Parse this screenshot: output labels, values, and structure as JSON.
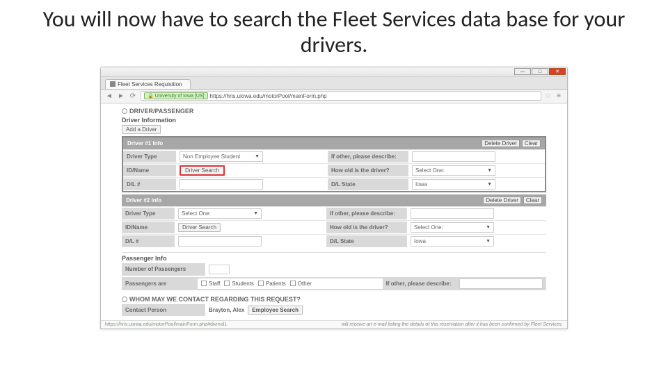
{
  "slide": {
    "title": "You will now have to search the Fleet Services data base for your drivers."
  },
  "browser": {
    "tab_title": "Fleet Services Requisition",
    "ev_badge": "University of Iowa [US]",
    "url": "https://hris.uiowa.edu/motorPool/mainForm.php",
    "status_url": "https://hris.uiowa.edu/motorPool/mainForm.php#divmid1",
    "status_note": "will receive an e-mail listing the details of this reservation after it has been confirmed by Fleet Services."
  },
  "form": {
    "section_header": "DRIVER/PASSENGER",
    "driver_info_heading": "Driver Information",
    "add_driver_btn": "Add a Driver",
    "driver_bars": [
      "Driver #1 Info",
      "Driver #2 Info"
    ],
    "bar_buttons": {
      "delete": "Delete Driver",
      "clear": "Clear"
    },
    "labels": {
      "driver_type": "Driver Type",
      "id_name": "ID/Name",
      "dl_num": "D/L #",
      "other_desc": "If other, please describe:",
      "how_old": "How old is the driver?",
      "dl_state": "D/L State"
    },
    "driver1": {
      "type": "Non Employee Student",
      "search_btn": "Driver Search",
      "age": "Select One:",
      "state": "Iowa"
    },
    "driver2": {
      "type": "Select One:",
      "search_btn": "Driver Search",
      "age": "Select One:",
      "state": "Iowa"
    },
    "passenger": {
      "heading": "Passenger Info",
      "num_label": "Number of Passengers",
      "are_label": "Passengers are",
      "options": [
        "Staff",
        "Students",
        "Patients",
        "Other"
      ],
      "other_label": "If other, please describe:"
    },
    "contact": {
      "header": "WHOM MAY WE CONTACT REGARDING THIS REQUEST?",
      "label": "Contact Person",
      "name": "Brayton, Alex",
      "search_btn": "Employee Search"
    }
  }
}
